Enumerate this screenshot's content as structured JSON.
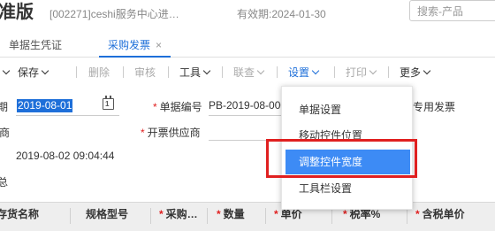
{
  "header": {
    "app_title": "准版",
    "account": "[002271]ceshi服务中心进…",
    "validity": "有效期:2024-01-30",
    "search_placeholder": "搜索-产品"
  },
  "tabs": [
    {
      "label": "单据生凭证",
      "active": false
    },
    {
      "label": "采购发票",
      "active": true,
      "close": "×"
    }
  ],
  "toolbar": {
    "items": [
      {
        "label": "存",
        "disabled": false,
        "dropdown": true
      },
      {
        "label": "保存",
        "disabled": false,
        "dropdown": true
      },
      {
        "label": "删除",
        "disabled": true,
        "dropdown": false
      },
      {
        "label": "审核",
        "disabled": true,
        "dropdown": false
      },
      {
        "label": "工具",
        "disabled": false,
        "dropdown": true
      },
      {
        "label": "联查",
        "disabled": true,
        "dropdown": true
      },
      {
        "label": "设置",
        "disabled": false,
        "dropdown": true,
        "active": true
      },
      {
        "label": "打印",
        "disabled": true,
        "dropdown": true
      },
      {
        "label": "更多",
        "disabled": false,
        "dropdown": true
      }
    ]
  },
  "form": {
    "date_label": "期",
    "date_value": "2019-08-01",
    "calendar_day": "1",
    "docno_label": "单据编号",
    "docno_value": "PB-2019-08-0001",
    "invoice_type_label": "专用发票",
    "row2_label": "商",
    "supplier_label": "开票供应商",
    "created_time": "2019-08-02 09:04:44",
    "summary_label": "总"
  },
  "settings_menu": {
    "items": [
      {
        "label": "单据设置",
        "highlighted": false
      },
      {
        "label": "移动控件位置",
        "highlighted": false
      },
      {
        "label": "调整控件宽度",
        "highlighted": true
      },
      {
        "label": "工具栏设置",
        "highlighted": false
      }
    ]
  },
  "table": {
    "columns": [
      {
        "label": "存货名称",
        "required": false
      },
      {
        "label": "规格型号",
        "required": false
      },
      {
        "label": "采购…",
        "required": true
      },
      {
        "label": "数量",
        "required": true
      },
      {
        "label": "单价",
        "required": true
      },
      {
        "label": "税率%",
        "required": true
      },
      {
        "label": "含税单价",
        "required": true
      }
    ]
  },
  "colors": {
    "accent": "#1e6fd9",
    "menu_highlight": "#3d8bf5",
    "annotation_red": "#e02020",
    "required_star": "#e02020",
    "table_header_bg": "#eeeeee"
  }
}
